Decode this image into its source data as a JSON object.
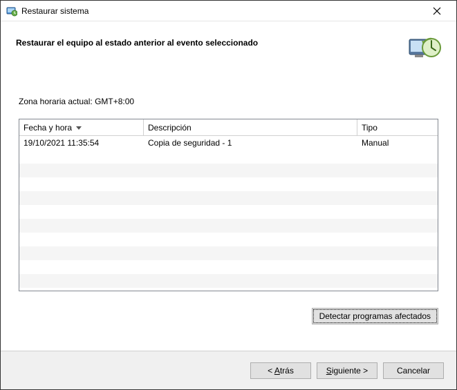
{
  "window": {
    "title": "Restaurar sistema"
  },
  "header": {
    "heading": "Restaurar el equipo al estado anterior al evento seleccionado"
  },
  "content": {
    "timezone_label": "Zona horaria actual: GMT+8:00",
    "columns": {
      "date": "Fecha y hora",
      "desc": "Descripción",
      "type": "Tipo"
    },
    "rows": [
      {
        "date": "19/10/2021 11:35:54",
        "desc": "Copia de seguridad - 1",
        "type": "Manual"
      }
    ],
    "detect_button": "Detectar programas afectados"
  },
  "footer": {
    "back_prefix": "< ",
    "back_u": "A",
    "back_rest": "trás",
    "next_prefix": "",
    "next_u": "S",
    "next_rest": "iguiente >",
    "cancel": "Cancelar"
  }
}
